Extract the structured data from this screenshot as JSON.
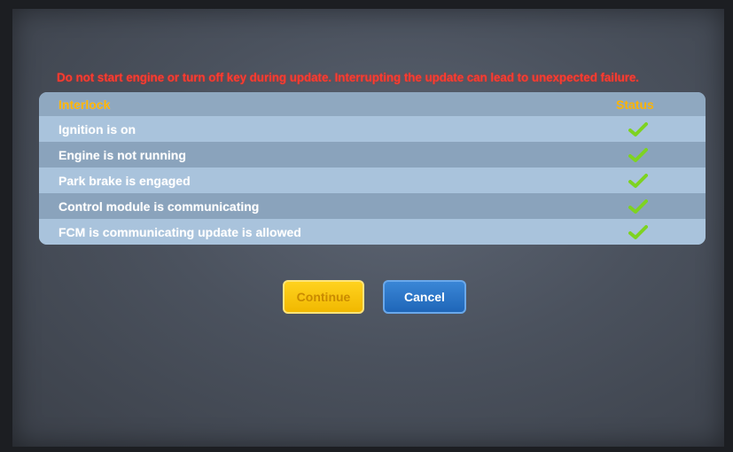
{
  "warning": "Do not start engine or turn off key during update. Interrupting the update can lead to unexpected failure.",
  "table": {
    "header": {
      "interlock": "Interlock",
      "status": "Status"
    },
    "rows": [
      {
        "label": "Ignition is on",
        "status": "ok"
      },
      {
        "label": "Engine is not running",
        "status": "ok"
      },
      {
        "label": "Park brake is engaged",
        "status": "ok"
      },
      {
        "label": "Control module is communicating",
        "status": "ok"
      },
      {
        "label": "FCM is communicating update is allowed",
        "status": "ok"
      }
    ]
  },
  "buttons": {
    "continue": "Continue",
    "cancel": "Cancel"
  },
  "colors": {
    "warning": "#ff3b2f",
    "header_text": "#ffb400",
    "check": "#7ed321",
    "continue_bg": "#ffd21f",
    "cancel_bg": "#2a76c8"
  },
  "icons": {
    "status": "checkmark-icon"
  }
}
